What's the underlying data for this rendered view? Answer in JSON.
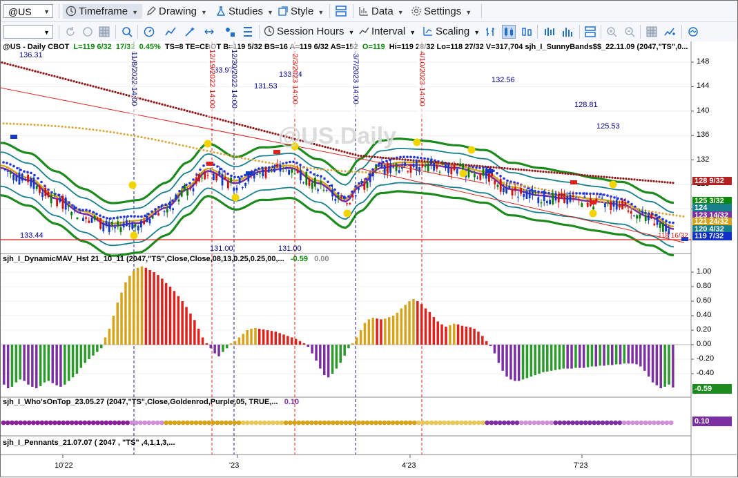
{
  "toolbar1": {
    "symbol": "@US",
    "timeframe": "Timeframe",
    "drawing": "Drawing",
    "studies": "Studies",
    "style": "Style",
    "data": "Data",
    "settings": "Settings"
  },
  "toolbar2": {
    "session_hours": "Session Hours",
    "interval": "Interval",
    "scaling": "Scaling"
  },
  "chart_header": {
    "symbol_line": "@US - Daily  CBOT",
    "l": "L=119 6/32",
    "change": "17/32",
    "pct": "0.45%",
    "rest": "TS=8  TE=CBOT  B=119 5/32  BS=16  A=119 6/32  AS=152",
    "o": "O=119",
    "hilo": "Hi=119 28/32  Lo=118 27/32  V=317,704  sjh_I_SunnyBands$$_22.11.09 (2047,\"TS\",0..."
  },
  "watermark": "@US.Daily",
  "price_axis": {
    "ticks": [
      "148",
      "144",
      "140",
      "136",
      "132",
      "128",
      "124"
    ],
    "tags": [
      {
        "text": "128 9/32",
        "color": "#b22222"
      },
      {
        "text": "125 3/32",
        "color": "#0a8a0a"
      },
      {
        "text": "124",
        "color": "#17808c"
      },
      {
        "text": "123 14/32",
        "color": "#7b2fa3"
      },
      {
        "text": "121 24/32",
        "color": "#d6a31a"
      },
      {
        "text": "120 4/32",
        "color": "#17808c"
      },
      {
        "text": "119 7/32",
        "color": "#1030c8"
      }
    ]
  },
  "price_labels": {
    "p1": "136.31",
    "p2": "133.44",
    "p3": "133.97",
    "p4": "131.53",
    "p5": "133.34",
    "p6": "132.56",
    "p7": "128.81",
    "p8": "125.53",
    "p9": "131.00",
    "p10": "131.00",
    "p11": "118 16/32"
  },
  "vertical_markers": [
    {
      "label": "11/8/2022 14:00",
      "color": "blue"
    },
    {
      "label": "12/19/2022 14:00",
      "color": "red"
    },
    {
      "label": "12/30/2022 14:00",
      "color": "blue"
    },
    {
      "label": "2/3/2023 14:00",
      "color": "red"
    },
    {
      "label": "3/7/2023 14:00",
      "color": "blue"
    },
    {
      "label": "4/10/2023 14:00",
      "color": "red"
    }
  ],
  "osc1": {
    "title": "sjh_I_DynamicMAV_Hst 21_10_11 (2047,\"TS\",Close,Close,08,13,0.25,0.25,00,...",
    "v1": "-0.59",
    "v2": "0.00",
    "ticks": [
      "1.00",
      "0.80",
      "0.60",
      "0.40",
      "0.20",
      "0.00",
      "-0.20",
      "-0.40"
    ],
    "tag": "-0.59"
  },
  "osc2": {
    "title": "sjh_I_Who'sOnTop_23.05.27 (2047,\"TS\",Close,Goldenrod,Purple,05,  TRUE,...",
    "v1": "0.10",
    "tag": "0.10"
  },
  "osc3": {
    "title": "sjh_I_Pennants_21.07.07 ( 2047 , \"TS\" ,4,1,1,3,..."
  },
  "time_axis": [
    "10'22",
    "'23",
    "4'23",
    "7'23"
  ],
  "histogram": {
    "values": [
      -0.55,
      -0.6,
      -0.58,
      -0.52,
      -0.48,
      -0.5,
      -0.55,
      -0.58,
      -0.6,
      -0.57,
      -0.52,
      -0.5,
      -0.53,
      -0.56,
      -0.58,
      -0.55,
      -0.5,
      -0.45,
      -0.4,
      -0.32,
      -0.25,
      -0.2,
      -0.15,
      -0.1,
      -0.05,
      0.1,
      0.22,
      0.4,
      0.58,
      0.72,
      0.86,
      0.95,
      1.02,
      1.06,
      1.08,
      1.06,
      1.03,
      1.0,
      0.96,
      0.91,
      0.85,
      0.8,
      0.74,
      0.67,
      0.6,
      0.52,
      0.43,
      0.34,
      0.22,
      0.1,
      0.02,
      -0.05,
      -0.12,
      -0.16,
      -0.1,
      -0.05,
      0.02,
      0.05,
      0.1,
      0.15,
      0.2,
      0.22,
      0.23,
      0.22,
      0.21,
      0.2,
      0.19,
      0.18,
      0.16,
      0.14,
      0.12,
      0.1,
      0.08,
      0.05,
      0.02,
      -0.03,
      -0.12,
      -0.22,
      -0.33,
      -0.42,
      -0.45,
      -0.4,
      -0.33,
      -0.25,
      -0.15,
      -0.05,
      0.02,
      0.1,
      0.2,
      0.3,
      0.35,
      0.37,
      0.36,
      0.35,
      0.36,
      0.38,
      0.4,
      0.44,
      0.5,
      0.55,
      0.6,
      0.63,
      0.6,
      0.56,
      0.5,
      0.45,
      0.38,
      0.32,
      0.28,
      0.25,
      0.27,
      0.29,
      0.28,
      0.26,
      0.25,
      0.24,
      0.22,
      0.18,
      0.12,
      0.05,
      -0.02,
      -0.12,
      -0.25,
      -0.36,
      -0.44,
      -0.48,
      -0.5,
      -0.5,
      -0.48,
      -0.46,
      -0.44,
      -0.42,
      -0.4,
      -0.38,
      -0.37,
      -0.36,
      -0.35,
      -0.34,
      -0.33,
      -0.33,
      -0.33,
      -0.32,
      -0.32,
      -0.32,
      -0.31,
      -0.3,
      -0.3,
      -0.29,
      -0.29,
      -0.28,
      -0.28,
      -0.27,
      -0.27,
      -0.26,
      -0.26,
      -0.26,
      -0.27,
      -0.3,
      -0.36,
      -0.44,
      -0.52,
      -0.56,
      -0.6,
      -0.58,
      -0.55,
      -0.59
    ]
  },
  "colors": {
    "bg": "#ffffff",
    "toolbar_bg": "#f5f7fa",
    "icon_blue": "#1f6fd1",
    "band_green": "#1c8a1c",
    "band_teal": "#17808c",
    "mav_purple": "#7b2fa3",
    "gold": "#d6a31a",
    "brown_dots": "#8b1a1a",
    "trend_red": "#e0201b",
    "hist_red": "#e0201b",
    "hist_gold": "#d6a31a",
    "hist_green": "#2a9a2a",
    "hist_purple": "#7b2fa3"
  }
}
